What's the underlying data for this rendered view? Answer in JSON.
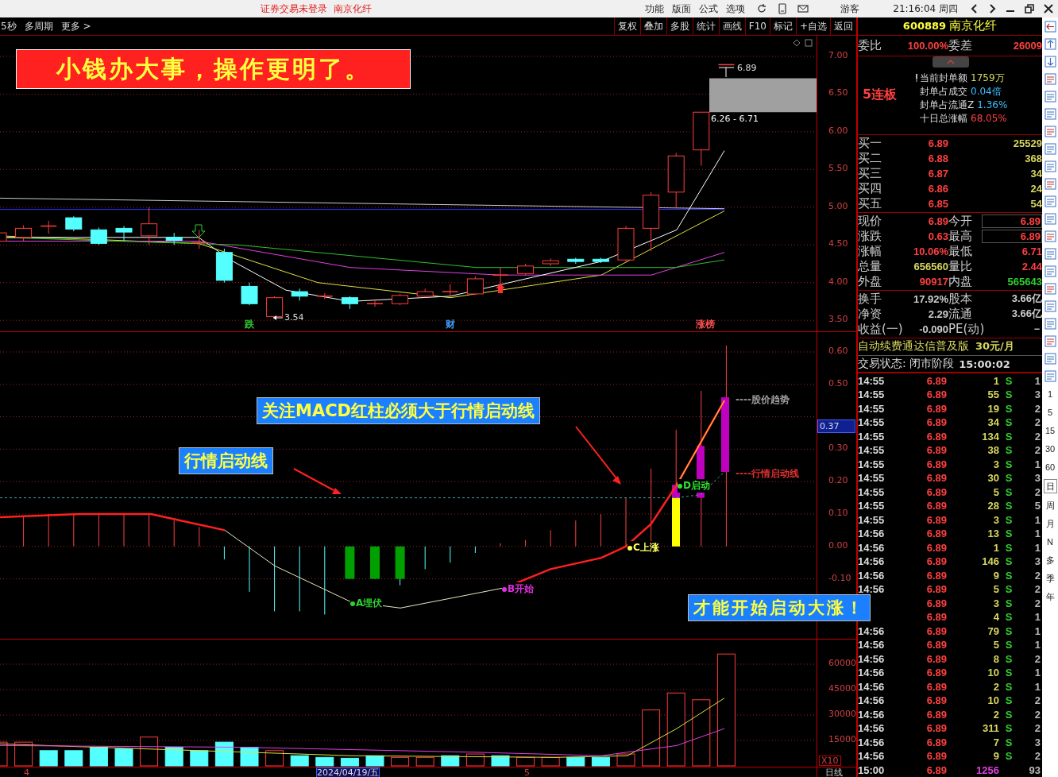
{
  "title_bar": {
    "notice": "证券交易未登录",
    "stock_name": "南京化纤",
    "menu": [
      "功能",
      "版面",
      "公式",
      "选项"
    ],
    "user": "游客",
    "clock": "21:16:04 周四"
  },
  "toolbar": {
    "links": [
      "5秒",
      "多周期",
      "更多 >"
    ],
    "buttons": [
      "复权",
      "叠加",
      "多股",
      "统计",
      "画线",
      "F10",
      "标记",
      "+自选",
      "返回"
    ]
  },
  "price_chart": {
    "banner": "小钱办大事，操作更明了。",
    "ticks": [
      "7.00",
      "6.50",
      "6.00",
      "5.50",
      "5.00",
      "4.50",
      "4.00",
      "3.50"
    ],
    "high_label": "6.89",
    "range_label": "6.26 - 6.71",
    "low_label": "3.54",
    "events": [
      {
        "text": "跌",
        "color": "#30d030"
      },
      {
        "text": "财",
        "color": "#40a0ff"
      },
      {
        "text": "涨榜",
        "color": "#ff5050"
      }
    ]
  },
  "macd_chart": {
    "ticks": [
      "0.60",
      "0.50",
      "0.30",
      "0.20",
      "0.10",
      "0.00",
      "-0.10"
    ],
    "current_value": "0.37",
    "callouts": [
      "关注MACD红柱必须大于行情启动线",
      "行情启动线",
      "才能开始启动大涨！"
    ],
    "points": [
      {
        "text": "A埋伏",
        "color": "#30d030"
      },
      {
        "text": "B开始",
        "color": "#e030e0"
      },
      {
        "text": "C上涨",
        "color": "#ffff60"
      },
      {
        "text": "D启动",
        "color": "#30e030"
      }
    ],
    "legend": [
      {
        "text": "----股价趋势",
        "color": "#a0a0a0"
      },
      {
        "text": "----行情启动线",
        "color": "#e03030"
      }
    ]
  },
  "volume_chart": {
    "ticks": [
      "60000",
      "45000",
      "30000",
      "15000"
    ],
    "scale": "X10"
  },
  "date_axis": {
    "labels": [
      {
        "text": "4",
        "selected": false
      },
      {
        "text": "2024/04/19/五",
        "selected": true
      },
      {
        "text": "5",
        "selected": false
      }
    ],
    "period": "日线"
  },
  "quote": {
    "code": "600889",
    "name": "南京化纤",
    "ratio": {
      "label": "委比",
      "value": "100.00%",
      "diff_label": "委差",
      "diff": "26009"
    },
    "streak": "5连板",
    "seal": [
      {
        "label": "当前封单额",
        "value": "1759万",
        "color": "#d8d860"
      },
      {
        "label": "封单占成交",
        "value": "0.04倍",
        "color": "#40c0ff"
      },
      {
        "label": "封单占流通Z",
        "value": "1.36%",
        "color": "#40c0ff"
      },
      {
        "label": "十日总涨幅",
        "value": "68.05%",
        "color": "#ff4040"
      }
    ],
    "bids": [
      {
        "label": "买一",
        "price": "6.89",
        "volume": "25529"
      },
      {
        "label": "买二",
        "price": "6.88",
        "volume": "368"
      },
      {
        "label": "买三",
        "price": "6.87",
        "volume": "34"
      },
      {
        "label": "买四",
        "price": "6.86",
        "volume": "24"
      },
      {
        "label": "买五",
        "price": "6.85",
        "volume": "54"
      }
    ],
    "stats": [
      {
        "cells": [
          {
            "label": "现价",
            "value": "6.89",
            "color": "#ff4040",
            "boxed": false
          },
          {
            "label": "今开",
            "value": "6.89",
            "color": "#ff4040",
            "boxed": true
          }
        ]
      },
      {
        "cells": [
          {
            "label": "涨跌",
            "value": "0.63",
            "color": "#ff4040",
            "boxed": false
          },
          {
            "label": "最高",
            "value": "6.89",
            "color": "#ff4040",
            "boxed": true
          }
        ]
      },
      {
        "cells": [
          {
            "label": "涨幅",
            "value": "10.06%",
            "color": "#ff4040",
            "boxed": false
          },
          {
            "label": "最低",
            "value": "6.71",
            "color": "#ff4040",
            "boxed": false
          }
        ]
      },
      {
        "cells": [
          {
            "label": "总量",
            "value": "656560",
            "color": "#d8d860",
            "boxed": false
          },
          {
            "label": "量比",
            "value": "2.44",
            "color": "#ff4040",
            "boxed": false
          }
        ]
      },
      {
        "cells": [
          {
            "label": "外盘",
            "value": "90917",
            "color": "#ff4040",
            "boxed": false
          },
          {
            "label": "内盘",
            "value": "565643",
            "color": "#30d030",
            "boxed": false
          }
        ]
      }
    ],
    "fundamentals": [
      {
        "cells": [
          {
            "label": "换手",
            "value": "17.92%"
          },
          {
            "label": "股本",
            "value": "3.66亿"
          }
        ]
      },
      {
        "cells": [
          {
            "label": "净资",
            "value": "2.29"
          },
          {
            "label": "流通",
            "value": "3.66亿"
          }
        ]
      },
      {
        "cells": [
          {
            "label": "收益(一)",
            "value": "-0.090"
          },
          {
            "label": "PE(动)",
            "value": "－"
          }
        ]
      }
    ],
    "promo": {
      "text": "自动续费通达信普及版",
      "price": "30元/月"
    },
    "status": {
      "label": "交易状态: 闭市阶段",
      "time": "15:00:02"
    },
    "trades": [
      {
        "kind": "tick",
        "time": "14:55",
        "price": "6.89",
        "volume": "1",
        "side": "S",
        "count": "1"
      },
      {
        "kind": "tick",
        "time": "14:55",
        "price": "6.89",
        "volume": "55",
        "side": "S",
        "count": "3"
      },
      {
        "kind": "tick",
        "time": "14:55",
        "price": "6.89",
        "volume": "19",
        "side": "S",
        "count": "2"
      },
      {
        "kind": "tick",
        "time": "14:55",
        "price": "6.89",
        "volume": "34",
        "side": "S",
        "count": "2"
      },
      {
        "kind": "tick",
        "time": "14:55",
        "price": "6.89",
        "volume": "134",
        "side": "S",
        "count": "2"
      },
      {
        "kind": "tick",
        "time": "14:55",
        "price": "6.89",
        "volume": "38",
        "side": "S",
        "count": "2"
      },
      {
        "kind": "tick",
        "time": "14:55",
        "price": "6.89",
        "volume": "3",
        "side": "S",
        "count": "1"
      },
      {
        "kind": "tick",
        "time": "14:55",
        "price": "6.89",
        "volume": "30",
        "side": "S",
        "count": "3"
      },
      {
        "kind": "tick",
        "time": "14:55",
        "price": "6.89",
        "volume": "5",
        "side": "S",
        "count": "2"
      },
      {
        "kind": "tick",
        "time": "14:55",
        "price": "6.89",
        "volume": "28",
        "side": "S",
        "count": "5"
      },
      {
        "kind": "tick",
        "time": "14:55",
        "price": "6.89",
        "volume": "3",
        "side": "S",
        "count": "1"
      },
      {
        "kind": "tick",
        "time": "14:56",
        "price": "6.89",
        "volume": "13",
        "side": "S",
        "count": "1"
      },
      {
        "kind": "tick",
        "time": "14:56",
        "price": "6.89",
        "volume": "1",
        "side": "S",
        "count": "1"
      },
      {
        "kind": "tick",
        "time": "14:56",
        "price": "6.89",
        "volume": "146",
        "side": "S",
        "count": "3"
      },
      {
        "kind": "tick",
        "time": "14:56",
        "price": "6.89",
        "volume": "9",
        "side": "S",
        "count": "2"
      },
      {
        "kind": "tick",
        "time": "14:56",
        "price": "6.89",
        "volume": "5",
        "side": "S",
        "count": "2"
      },
      {
        "kind": "tick",
        "price": "6.89",
        "volume": "3",
        "side": "S",
        "count": "2"
      },
      {
        "kind": "tick",
        "price": "6.89",
        "volume": "4",
        "side": "S",
        "count": "1"
      },
      {
        "kind": "tick",
        "time": "14:56",
        "price": "6.89",
        "volume": "79",
        "side": "S",
        "count": "1"
      },
      {
        "kind": "tick",
        "time": "14:56",
        "price": "6.89",
        "volume": "5",
        "side": "S",
        "count": "1"
      },
      {
        "kind": "tick",
        "time": "14:56",
        "price": "6.89",
        "volume": "8",
        "side": "S",
        "count": "2"
      },
      {
        "kind": "tick",
        "time": "14:56",
        "price": "6.89",
        "volume": "10",
        "side": "S",
        "count": "1"
      },
      {
        "kind": "tick",
        "time": "14:56",
        "price": "6.89",
        "volume": "2",
        "side": "S",
        "count": "1"
      },
      {
        "kind": "tick",
        "time": "14:56",
        "price": "6.89",
        "volume": "10",
        "side": "S",
        "count": "2"
      },
      {
        "kind": "tick",
        "time": "14:56",
        "price": "6.89",
        "volume": "2",
        "side": "S",
        "count": "2"
      },
      {
        "kind": "tick",
        "time": "14:56",
        "price": "6.89",
        "volume": "311",
        "side": "S",
        "count": "2"
      },
      {
        "kind": "tick",
        "time": "14:56",
        "price": "6.89",
        "volume": "7",
        "side": "S",
        "count": "3"
      },
      {
        "kind": "tick",
        "time": "14:56",
        "price": "6.89",
        "volume": "9",
        "side": "S",
        "count": "2"
      },
      {
        "kind": "summary",
        "time": "15:00",
        "price": "6.89",
        "volume": "1256",
        "count": "93"
      }
    ]
  },
  "side_toolbar": {
    "periods": [
      {
        "label": "1",
        "selected": false
      },
      {
        "label": "5",
        "selected": false
      },
      {
        "label": "15",
        "selected": false
      },
      {
        "label": "30",
        "selected": false
      },
      {
        "label": "60",
        "selected": false
      },
      {
        "label": "日",
        "selected": true
      },
      {
        "label": "周",
        "selected": false
      },
      {
        "label": "月",
        "selected": false
      },
      {
        "label": "N",
        "selected": false
      },
      {
        "label": "多",
        "selected": false
      },
      {
        "label": "季",
        "selected": false
      },
      {
        "label": "年",
        "selected": false
      }
    ]
  }
}
